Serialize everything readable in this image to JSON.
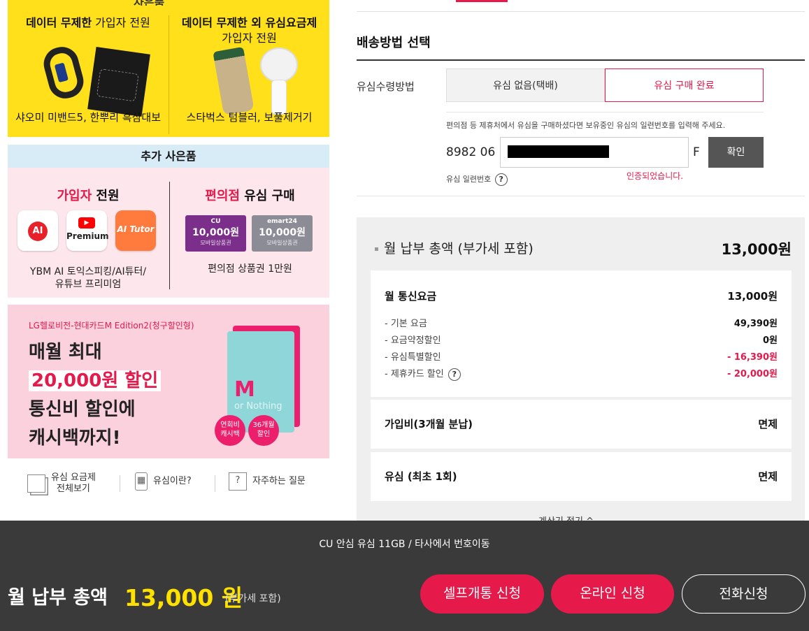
{
  "left": {
    "yellow": {
      "top_cut_text": "사은품",
      "col1_title_bold": "데이터 무제한",
      "col1_title_thin": " 가입자 전원",
      "col1_caption": "샤오미 미밴드5, 한뿌리 흑삼대보",
      "col2_title_line1": "데이터 무제한 외 유심요금제",
      "col2_title_line2": "가입자 전원",
      "col2_caption": "스타벅스 텀블러, 보풀제거기"
    },
    "extra_gift_header": "추가 사은품",
    "pink1": {
      "col1_title_red": "가입자",
      "col1_title_rest": " 전원",
      "app1_text": "AI",
      "app2_text": "Premium",
      "app3_text": "AI Tutor",
      "col1_caption_line1": "YBM AI 토익스피킹/AI튜터/",
      "col1_caption_line2": "유튜브 프리미엄",
      "col2_title_red": "편의점",
      "col2_title_rest": " 유심 구매",
      "gift1_logo": "CU",
      "gift1_amount": "10,000원",
      "gift1_sub": "모바일상품권",
      "gift2_logo": "emart24",
      "gift2_amount": "10,000원",
      "gift2_sub": "모바일상품권",
      "col2_caption": "편의점 상품권 1만원"
    },
    "pink2": {
      "small": "LG헬로비전-현대카드M Edition2(청구할인형)",
      "line1": "매월 최대",
      "line2": "20,000원 할인",
      "line3": "통신비 할인에",
      "line4": "캐시백까지!",
      "card_letter": "M",
      "card_sub": "or Nothing",
      "badge1_l1": "연회비",
      "badge1_l2": "캐시백",
      "badge2_l1": "36개월",
      "badge2_l2": "할인"
    },
    "links": {
      "link1_l1": "유심 요금제",
      "link1_l2": "전체보기",
      "link2": "유심이란?",
      "link3_icon": "?",
      "link3": "자주하는 질문"
    }
  },
  "right": {
    "section_title": "배송방법 선택",
    "receive_label": "유심수령방법",
    "options": [
      "유심 없음(택배)",
      "유심 구매 완료"
    ],
    "notice": "편의점 등 제휴처에서 유심을 구매하셨다면 보유중인 유심의 일련번호를 입력해 주세요.",
    "serial_prefix": "8982 06",
    "serial_suffix": "F",
    "confirm_label": "확인",
    "serial_label": "유심 일련번호",
    "help_icon": "?",
    "verified_text": "인증되었습니다.",
    "summary": {
      "title": "월 납부 총액 (부가세 포함)",
      "total": "13,000원",
      "monthly_title": "월 통신요금",
      "monthly_value": "13,000원",
      "rows": [
        {
          "label": "- 기본 요금",
          "value": "49,390원"
        },
        {
          "label": "- 요금약정할인",
          "value": "0원"
        },
        {
          "label": "- 유심특별할인",
          "value": "- 16,390원"
        },
        {
          "label": "- 제휴카드 할인",
          "value": "- 20,000원"
        }
      ],
      "joinfee_title": "가입비(3개월 분납)",
      "joinfee_value": "면제",
      "usim_title": "유심 (최초 1회)",
      "usim_value": "면제",
      "calc_toggle": "계산기 접기 ^"
    }
  },
  "bottom": {
    "plan_name": "CU 안심 유심 11GB / 타사에서 번호이동",
    "total_label": "월 납부 총액",
    "total_amount": "13,000 원",
    "vat_note": "(부가세 포함)",
    "btn_self": "셀프개통 신청",
    "btn_online": "온라인 신청",
    "btn_phone": "전화신청"
  },
  "colors": {
    "accent": "#e6194b",
    "yellow": "#ffe01a",
    "amount": "#ffe100",
    "bar": "#3a3a3a"
  }
}
